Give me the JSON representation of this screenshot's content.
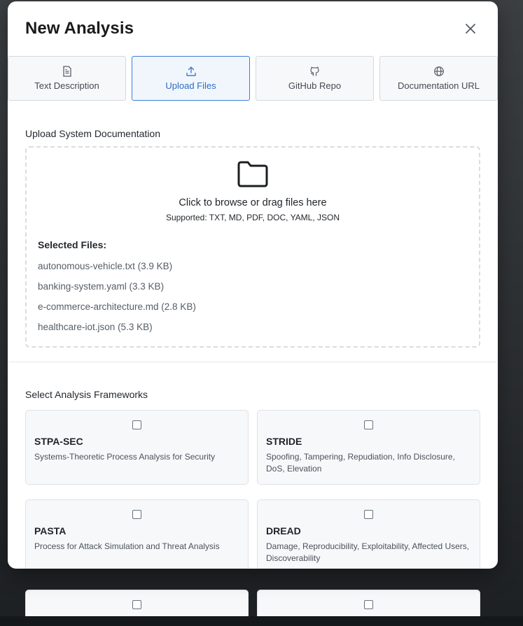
{
  "modal": {
    "title": "New Analysis"
  },
  "tabs": [
    {
      "label": "Text Description",
      "icon": "document-icon",
      "active": false
    },
    {
      "label": "Upload Files",
      "icon": "upload-icon",
      "active": true
    },
    {
      "label": "GitHub Repo",
      "icon": "github-icon",
      "active": false
    },
    {
      "label": "Documentation URL",
      "icon": "globe-icon",
      "active": false
    }
  ],
  "upload": {
    "section_label": "Upload System Documentation",
    "dropzone_text": "Click to browse or drag files here",
    "supported_text": "Supported: TXT, MD, PDF, DOC, YAML, JSON",
    "selected_title": "Selected Files:",
    "files": [
      "autonomous-vehicle.txt (3.9 KB)",
      "banking-system.yaml (3.3 KB)",
      "e-commerce-architecture.md (2.8 KB)",
      "healthcare-iot.json (5.3 KB)"
    ]
  },
  "frameworks": {
    "section_label": "Select Analysis Frameworks",
    "items": [
      {
        "name": "STPA-SEC",
        "desc": "Systems-Theoretic Process Analysis for Security",
        "checked": false
      },
      {
        "name": "STRIDE",
        "desc": "Spoofing, Tampering, Repudiation, Info Disclosure, DoS, Elevation",
        "checked": false
      },
      {
        "name": "PASTA",
        "desc": "Process for Attack Simulation and Threat Analysis",
        "checked": false
      },
      {
        "name": "DREAD",
        "desc": "Damage, Reproducibility, Exploitability, Affected Users, Discoverability",
        "checked": false
      }
    ]
  },
  "colors": {
    "accent": "#3b7fd1",
    "backdrop": "#2c2f31"
  }
}
